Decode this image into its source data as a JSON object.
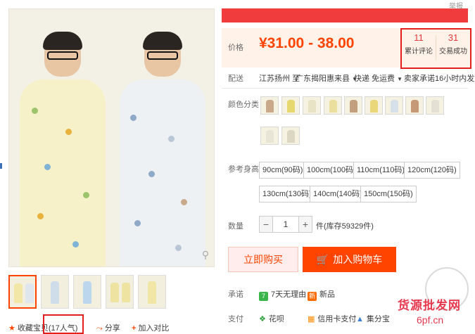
{
  "header": {
    "top_text": "举报"
  },
  "gallery": {
    "magnify_icon": "search-icon"
  },
  "actions": {
    "favorite_label": "收藏宝贝",
    "favorite_count": "(17人气)",
    "share_label": "分享",
    "compare_label": "加入对比"
  },
  "price": {
    "label": "价格",
    "value": "¥31.00 - 38.00"
  },
  "stats": {
    "reviews_count": "11",
    "reviews_label": "累计评论",
    "trades_count": "31",
    "trades_label": "交易成功"
  },
  "shipping": {
    "label": "配送",
    "from": "江苏扬州 至",
    "to": "广东揭阳惠来县",
    "method": "快递 免运费",
    "promise": "卖家承诺16小时内发货"
  },
  "color": {
    "label": "颜色分类"
  },
  "sizes": {
    "label": "参考身高",
    "options": [
      "90cm(90码)",
      "100cm(100码)",
      "110cm(110码)",
      "120cm(120码)",
      "130cm(130码)",
      "140cm(140码)",
      "150cm(150码)"
    ]
  },
  "quantity": {
    "label": "数量",
    "value": "1",
    "minus": "−",
    "plus": "+",
    "stock": "件(库存59329件)"
  },
  "buttons": {
    "buy_now": "立即购买",
    "add_to_cart": "加入购物车"
  },
  "promise": {
    "label": "承诺",
    "items": [
      "7天无理由",
      "新品"
    ],
    "badges": [
      "7",
      "新"
    ]
  },
  "payment": {
    "label": "支付",
    "items": [
      "花呗",
      "信用卡支付",
      "集分宝"
    ]
  },
  "watermark": {
    "line1": "货源批发网",
    "line2": "6pf.cn"
  },
  "colors": {
    "accent": "#ff4400",
    "price": "#ff4400",
    "highlight_box": "#e4201e",
    "green": "#3ab54a",
    "orange": "#ff8a00"
  }
}
